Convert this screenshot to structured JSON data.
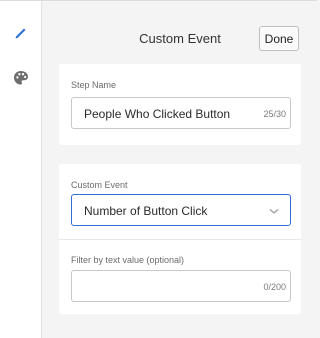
{
  "rail": {
    "edit_icon": "pencil-icon",
    "style_icon": "palette-icon",
    "accent": "#2f6fd6"
  },
  "header": {
    "title": "Custom Event",
    "done_label": "Done"
  },
  "step_card": {
    "label": "Step Name",
    "value": "People Who Clicked Button",
    "counter": "25/30"
  },
  "event_card": {
    "event_label": "Custom Event",
    "event_selected": "Number of Button Click",
    "filter_label": "Filter by text value (optional)",
    "filter_value": "",
    "filter_counter": "0/200"
  }
}
